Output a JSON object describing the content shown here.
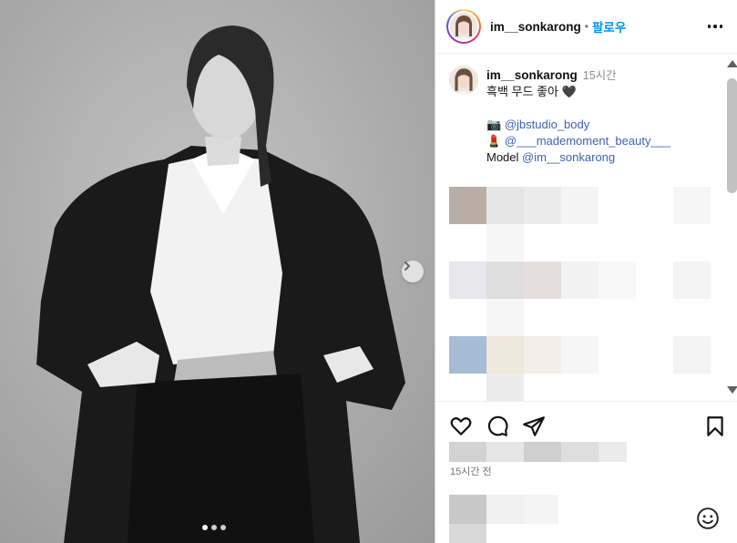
{
  "header": {
    "username": "im__sonkarong",
    "separator": "•",
    "follow_label": "팔로우"
  },
  "caption": {
    "username": "im__sonkarong",
    "time": "15시간",
    "line1": "흑백 무드 좋아 🖤",
    "camera_emoji": "📷",
    "studio_handle": "@jbstudio_body",
    "lipstick_emoji": "💄",
    "beauty_handle": "@___mademoment_beauty___",
    "model_label": "Model",
    "model_handle": "@im__sonkarong"
  },
  "post": {
    "timestamp": "15시간 전"
  },
  "carousel": {
    "total_dots": 3,
    "active_index": 0
  },
  "icons": [
    "heart-icon",
    "comment-icon",
    "share-icon",
    "bookmark-icon",
    "more-icon",
    "chevron-right-icon",
    "emoji-icon"
  ],
  "colors": {
    "follow_blue": "#0095f6",
    "link_blue": "#3c63b4"
  }
}
